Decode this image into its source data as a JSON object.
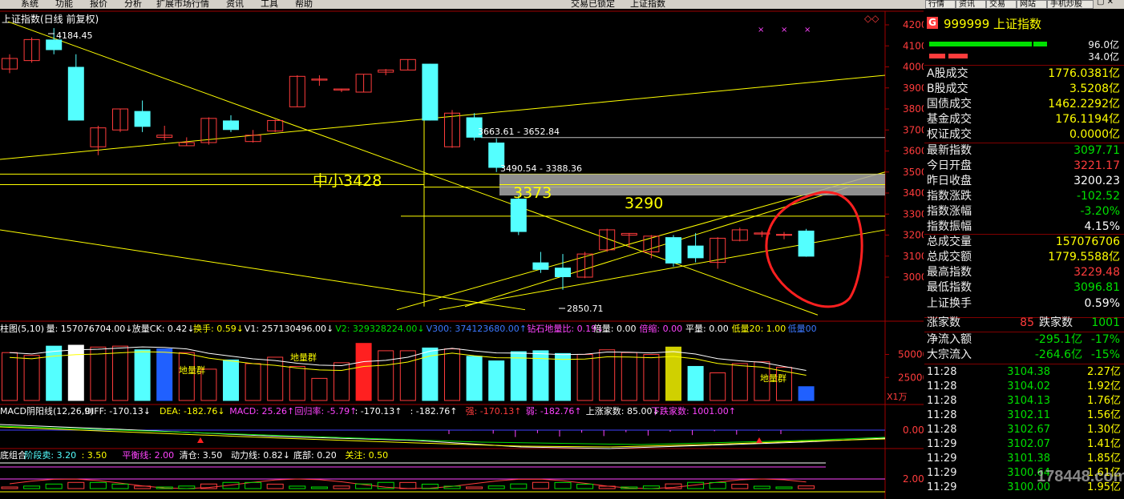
{
  "menu": {
    "items": [
      "系统",
      "功能",
      "报价",
      "分析",
      "扩展市场行情",
      "资讯",
      "工具",
      "帮助"
    ],
    "status": "交易已锁定",
    "index_title": "上证指数",
    "right_buttons": [
      "行情",
      "资讯",
      "交易",
      "网站",
      "手机炒股"
    ]
  },
  "chart_header": "上证指数(日线 前复权)",
  "colors": {
    "up": "#ff3c3c",
    "down": "#54ffff",
    "axis": "#a00000",
    "yellow": "#ffff00"
  },
  "chart_data": [
    {
      "type": "candlestick",
      "title": "上证指数(日线 前复权)",
      "ylim": [
        2800,
        4250
      ],
      "yticks": [
        3000,
        3100,
        3200,
        3300,
        3400,
        3500,
        3600,
        3700,
        3800,
        3900,
        4000,
        4100,
        4200
      ],
      "candles": [
        {
          "o": 3990,
          "c": 4040,
          "h": 4060,
          "l": 3970
        },
        {
          "o": 4030,
          "c": 4130,
          "h": 4140,
          "l": 4020
        },
        {
          "o": 4130,
          "c": 4080,
          "h": 4184.45,
          "l": 4060
        },
        {
          "o": 4000,
          "c": 3745,
          "h": 4060,
          "l": 3745
        },
        {
          "o": 3620,
          "c": 3710,
          "h": 3720,
          "l": 3580
        },
        {
          "o": 3700,
          "c": 3800,
          "h": 3800,
          "l": 3690
        },
        {
          "o": 3790,
          "c": 3715,
          "h": 3840,
          "l": 3690
        },
        {
          "o": 3665,
          "c": 3675,
          "h": 3720,
          "l": 3650
        },
        {
          "o": 3625,
          "c": 3640,
          "h": 3665,
          "l": 3625
        },
        {
          "o": 3640,
          "c": 3755,
          "h": 3760,
          "l": 3630
        },
        {
          "o": 3745,
          "c": 3700,
          "h": 3770,
          "l": 3690
        },
        {
          "o": 3645,
          "c": 3675,
          "h": 3700,
          "l": 3640
        },
        {
          "o": 3695,
          "c": 3745,
          "h": 3750,
          "l": 3690
        },
        {
          "o": 3810,
          "c": 3955,
          "h": 3960,
          "l": 3810
        },
        {
          "o": 3937,
          "c": 3942,
          "h": 3960,
          "l": 3910
        },
        {
          "o": 3890,
          "c": 3895,
          "h": 3895,
          "l": 3880
        },
        {
          "o": 3880,
          "c": 3965,
          "h": 3965,
          "l": 3880
        },
        {
          "o": 3975,
          "c": 3985,
          "h": 3990,
          "l": 3960
        },
        {
          "o": 3985,
          "c": 4035,
          "h": 4035,
          "l": 3985
        },
        {
          "o": 4015,
          "c": 3745,
          "h": 4015,
          "l": 3745
        },
        {
          "o": 3620,
          "c": 3780,
          "h": 3795,
          "l": 3615
        },
        {
          "o": 3760,
          "c": 3663.61,
          "h": 3780,
          "l": 3650
        },
        {
          "o": 3640,
          "c": 3520,
          "h": 3660,
          "l": 3500
        },
        {
          "o": 3373,
          "c": 3215,
          "h": 3390,
          "l": 3200
        },
        {
          "o": 3070,
          "c": 3035,
          "h": 3120,
          "l": 3020
        },
        {
          "o": 3045,
          "c": 3000,
          "h": 3110,
          "l": 2940
        },
        {
          "o": 3000,
          "c": 3110,
          "h": 3120,
          "l": 2995
        },
        {
          "o": 3130,
          "c": 3225,
          "h": 3230,
          "l": 3120
        },
        {
          "o": 3200,
          "c": 3208,
          "h": 3210,
          "l": 3140
        },
        {
          "o": 3120,
          "c": 3195,
          "h": 3200,
          "l": 3090
        },
        {
          "o": 3190,
          "c": 3065,
          "h": 3200,
          "l": 3050
        },
        {
          "o": 3150,
          "c": 3090,
          "h": 3210,
          "l": 3070
        },
        {
          "o": 3070,
          "c": 3185,
          "h": 3190,
          "l": 3040
        },
        {
          "o": 3175,
          "c": 3225,
          "h": 3235,
          "l": 3170
        },
        {
          "o": 3205,
          "c": 3210,
          "h": 3220,
          "l": 3190
        },
        {
          "o": 3200,
          "c": 3203,
          "h": 3215,
          "l": 3180
        },
        {
          "o": 3221.17,
          "c": 3097.71,
          "h": 3229.48,
          "l": 3096.81
        }
      ],
      "annotations": [
        "4184.45",
        "3663.61 - 3652.84",
        "3490.54 - 3388.36",
        "中小3428",
        "3373",
        "3290",
        "2850.71"
      ]
    },
    {
      "type": "bar",
      "title": "柱图(5,10)",
      "yticks": [
        25000,
        50000
      ],
      "values": [
        52000,
        49000,
        59000,
        60000,
        58000,
        59000,
        55000,
        56000,
        52000,
        34000,
        44000,
        40000,
        47000,
        37000,
        24000,
        41000,
        62000,
        54000,
        54000,
        57000,
        56000,
        48000,
        43000,
        53000,
        54000,
        51000,
        50000,
        55000,
        52000,
        50000,
        58000,
        37000,
        30000,
        40000,
        42000,
        36000,
        15000
      ]
    },
    {
      "type": "line",
      "title": "MACD阴阳线(12,26,9)",
      "yticks": [
        0.0
      ]
    },
    {
      "type": "line",
      "title": "底组合",
      "yticks": [
        2.0
      ]
    }
  ],
  "volume_legend": [
    {
      "text": "柱图(5,10)",
      "color": "#ffffff"
    },
    {
      "text": "量: 157076704.00↓",
      "color": "#ffffff"
    },
    {
      "text": "放量CK: 0.42↓",
      "color": "#ffffff"
    },
    {
      "text": "换手: 0.59↓",
      "color": "#ffff00"
    },
    {
      "text": "V1: 257130496.00↓",
      "color": "#ffffff"
    },
    {
      "text": "V2: 329328224.00↓",
      "color": "#00e000"
    },
    {
      "text": "V300: 374123680.00↑",
      "color": "#3c78ff"
    },
    {
      "text": "钻石地量比: 0.19↓",
      "color": "#ff44ff"
    },
    {
      "text": "倍量: 0.00",
      "color": "#ffffff"
    },
    {
      "text": "倍缩: 0.00",
      "color": "#ff44ff"
    },
    {
      "text": "平量: 0.00",
      "color": "#ffffff"
    },
    {
      "text": "低量20: 1.00",
      "color": "#ffff00"
    },
    {
      "text": "低量00",
      "color": "#3c78ff"
    }
  ],
  "volume_labels": [
    "地量群",
    "地量群",
    "地量群"
  ],
  "volume_unit": "X1万",
  "macd_legend": [
    {
      "text": "MACD阴阳线(12,26,9)",
      "color": "#ffffff"
    },
    {
      "text": "DIFF: -170.13↓",
      "color": "#ffffff"
    },
    {
      "text": "DEA: -182.76↓",
      "color": "#ffff00"
    },
    {
      "text": "MACD: 25.26↑",
      "color": "#ff44ff"
    },
    {
      "text": "回归率: -5.79↑",
      "color": "#ff44ff"
    },
    {
      "text": ": -170.13↑",
      "color": "#ffffff"
    },
    {
      "text": ": -182.76↑",
      "color": "#ffffff"
    },
    {
      "text": "强: -170.13↑",
      "color": "#ff3c3c"
    },
    {
      "text": "弱: -182.76↑",
      "color": "#ff44ff"
    },
    {
      "text": "上涨家数: 85.00↓",
      "color": "#ffffff"
    },
    {
      "text": "下跌家数: 1001.00↑",
      "color": "#ff44ff"
    }
  ],
  "bottom_legend": [
    {
      "text": "底组合",
      "color": "#ffffff"
    },
    {
      "text": "阶段卖: 3.20",
      "color": "#54ffff"
    },
    {
      "text": ": 3.50",
      "color": "#ffff00"
    },
    {
      "text": "平衡线: 2.00",
      "color": "#ff44ff"
    },
    {
      "text": "清仓: 3.50",
      "color": "#ffffff"
    },
    {
      "text": "动力线: 0.82↓",
      "color": "#ffffff"
    },
    {
      "text": "底部: 0.20",
      "color": "#ffffff"
    },
    {
      "text": "关注: 0.50",
      "color": "#ffff00"
    }
  ],
  "quote": {
    "badge": "G",
    "code_name": "999999 上证指数",
    "bar1_value": "96.0亿",
    "bar2_value": "34.0亿",
    "stats": [
      {
        "label": "A股成交",
        "value": "1776.0381亿",
        "color": "#ffff00"
      },
      {
        "label": "B股成交",
        "value": "3.5208亿",
        "color": "#ffff00"
      },
      {
        "label": "国债成交",
        "value": "1462.2292亿",
        "color": "#ffff00"
      },
      {
        "label": "基金成交",
        "value": "176.1194亿",
        "color": "#ffff00"
      },
      {
        "label": "权证成交",
        "value": "0.0000亿",
        "color": "#ffff00"
      },
      {
        "label": "最新指数",
        "value": "3097.71",
        "color": "#00e000"
      },
      {
        "label": "今日开盘",
        "value": "3221.17",
        "color": "#ff3c3c"
      },
      {
        "label": "昨日收盘",
        "value": "3200.23",
        "color": "#ffffff"
      },
      {
        "label": "指数涨跌",
        "value": "-102.52",
        "color": "#00e000"
      },
      {
        "label": "指数涨幅",
        "value": "-3.20%",
        "color": "#00e000"
      },
      {
        "label": "指数振幅",
        "value": "4.15%",
        "color": "#ffffff"
      },
      {
        "label": "总成交量",
        "value": "157076706",
        "color": "#ffff00"
      },
      {
        "label": "总成交额",
        "value": "1779.5588亿",
        "color": "#ffff00"
      },
      {
        "label": "最高指数",
        "value": "3229.48",
        "color": "#ff3c3c"
      },
      {
        "label": "最低指数",
        "value": "3096.81",
        "color": "#00e000"
      },
      {
        "label": "上证换手",
        "value": "0.59%",
        "color": "#ffffff"
      }
    ],
    "up_label": "涨家数",
    "up_count": "85",
    "down_label": "跌家数",
    "down_count": "1001",
    "flows": [
      {
        "label": "净流入额",
        "value": "-295.1亿",
        "pct": "-17%"
      },
      {
        "label": "大宗流入",
        "value": "-264.6亿",
        "pct": "-15%"
      }
    ],
    "ticks": [
      {
        "time": "11:28",
        "price": "3104.38",
        "chg": "2.27亿"
      },
      {
        "time": "11:28",
        "price": "3104.02",
        "chg": "1.92亿"
      },
      {
        "time": "11:28",
        "price": "3104.13",
        "chg": "1.76亿"
      },
      {
        "time": "11:28",
        "price": "3102.11",
        "chg": "1.56亿"
      },
      {
        "time": "11:28",
        "price": "3102.67",
        "chg": "1.30亿"
      },
      {
        "time": "11:29",
        "price": "3102.07",
        "chg": "1.41亿"
      },
      {
        "time": "11:29",
        "price": "3101.38",
        "chg": "1.85亿"
      },
      {
        "time": "11:29",
        "price": "3100.64",
        "chg": "1.61亿"
      },
      {
        "time": "11:29",
        "price": "3100.00",
        "chg": "1.95亿"
      }
    ]
  },
  "watermark": "178448.com"
}
